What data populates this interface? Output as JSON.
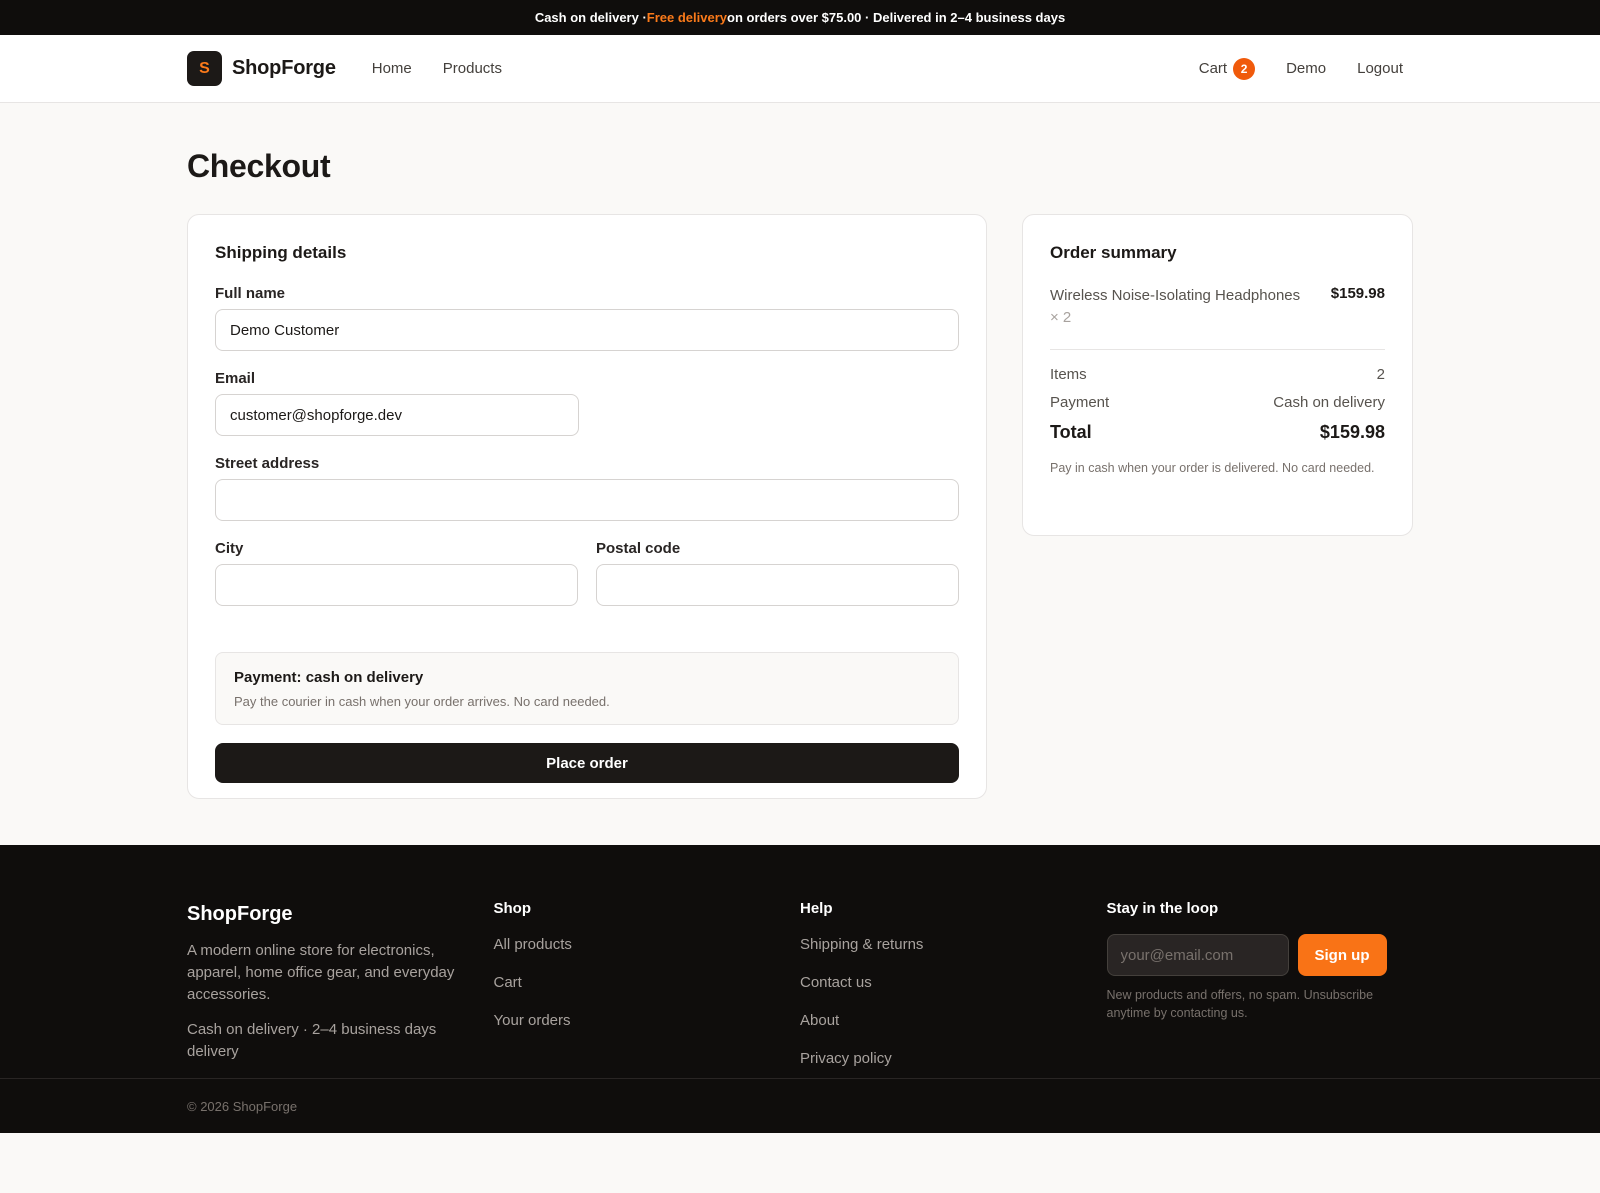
{
  "announcement": {
    "part1": "Cash on delivery · ",
    "highlight": "Free delivery",
    "part2": " on orders over $75.00 · Delivered in 2–4 business days"
  },
  "nav": {
    "logo_letter": "S",
    "brand": "ShopForge",
    "links": [
      "Home",
      "Products"
    ],
    "cart_label": "Cart",
    "cart_count": "2",
    "user": "Demo",
    "logout": "Logout"
  },
  "page": {
    "title": "Checkout"
  },
  "shipping": {
    "title": "Shipping details",
    "full_name_label": "Full name",
    "full_name_value": "Demo Customer",
    "email_label": "Email",
    "email_value": "customer@shopforge.dev",
    "street_label": "Street address",
    "street_value": "",
    "city_label": "City",
    "city_value": "",
    "postal_label": "Postal code",
    "postal_value": "",
    "payment_title": "Payment: cash on delivery",
    "payment_desc": "Pay the courier in cash when your order arrives. No card needed.",
    "place_order": "Place order"
  },
  "summary": {
    "title": "Order summary",
    "item_name": "Wireless Noise-Isolating Headphones",
    "item_qty": "× 2",
    "item_price": "$159.98",
    "items_label": "Items",
    "items_value": "2",
    "payment_label": "Payment",
    "payment_value": "Cash on delivery",
    "total_label": "Total",
    "total_value": "$159.98",
    "note": "Pay in cash when your order is delivered. No card needed."
  },
  "footer": {
    "brand": "ShopForge",
    "desc": "A modern online store for electronics, apparel, home office gear, and everyday accessories.",
    "delivery": "Cash on delivery · 2–4 business days delivery",
    "shop_title": "Shop",
    "shop_links": [
      "All products",
      "Cart",
      "Your orders"
    ],
    "help_title": "Help",
    "help_links": [
      "Shipping & returns",
      "Contact us",
      "About",
      "Privacy policy"
    ],
    "news_title": "Stay in the loop",
    "news_placeholder": "your@email.com",
    "signup": "Sign up",
    "news_note": "New products and offers, no spam. Unsubscribe anytime by contacting us.",
    "copyright": "© 2026 ShopForge"
  }
}
